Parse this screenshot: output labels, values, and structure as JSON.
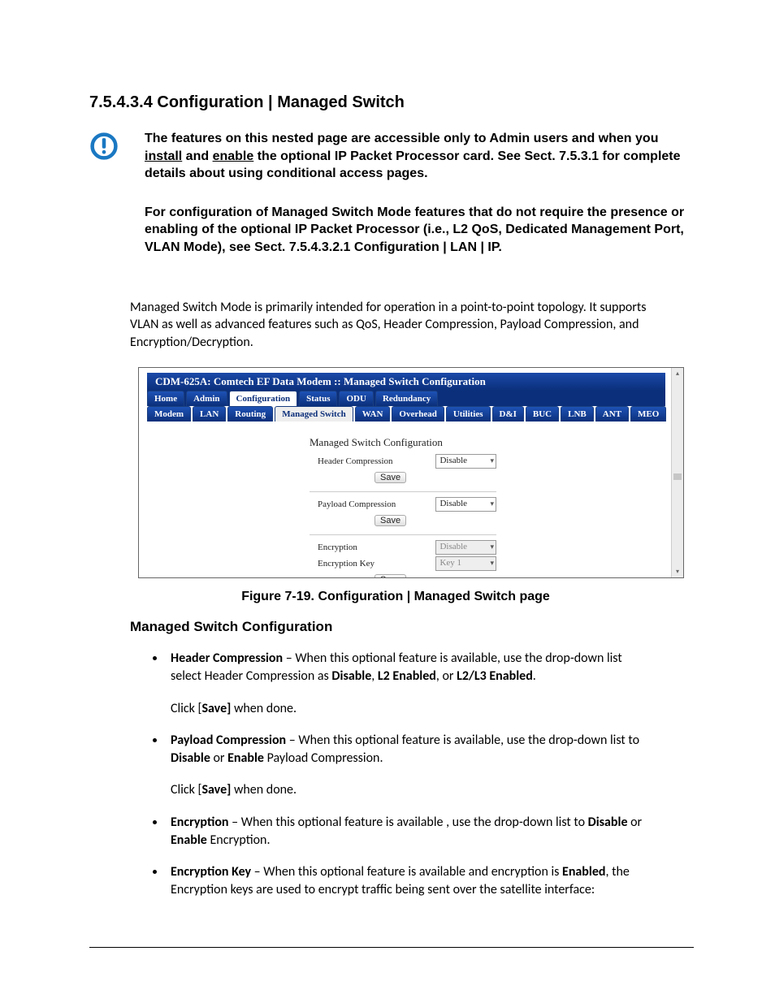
{
  "heading": "7.5.4.3.4 Configuration | Managed Switch",
  "note": {
    "p1_a": "The features on this nested page are accessible only to Admin users and when you ",
    "p1_u1": "install",
    "p1_b": " and ",
    "p1_u2": "enable",
    "p1_c": " the optional IP Packet Processor card. See Sect. 7.5.3.1 for complete details about using conditional access pages.",
    "p2": "For configuration of Managed Switch Mode features that do not require the presence or enabling of the optional IP Packet Processor (i.e., L2 QoS, Dedicated Management Port, VLAN Mode), see Sect. 7.5.4.3.2.1 Configuration | LAN | IP."
  },
  "intro": "Managed Switch Mode is primarily intended for operation in a point-to-point topology. It supports VLAN as well as advanced features such as QoS, Header Compression, Payload Compression, and Encryption/Decryption.",
  "fig": {
    "titlebar": "CDM-625A: Comtech EF Data Modem :: Managed Switch Configuration",
    "tabs1": [
      "Home",
      "Admin",
      "Configuration",
      "Status",
      "ODU",
      "Redundancy"
    ],
    "tabs1_active": "Configuration",
    "tabs2": [
      "Modem",
      "LAN",
      "Routing",
      "Managed Switch",
      "WAN",
      "Overhead",
      "Utilities",
      "D&I",
      "BUC",
      "LNB",
      "ANT",
      "MEO"
    ],
    "tabs2_active": "Managed Switch",
    "form": {
      "title": "Managed Switch Configuration",
      "hc_label": "Header Compression",
      "hc_value": "Disable",
      "pc_label": "Payload Compression",
      "pc_value": "Disable",
      "enc_label": "Encryption",
      "enc_value": "Disable",
      "key_label": "Encryption Key",
      "key_value": "Key 1",
      "save": "Save"
    }
  },
  "caption": "Figure 7-19. Configuration | Managed Switch page",
  "subhead": "Managed Switch Configuration",
  "list": {
    "hc_bold": "Header Compression",
    "hc_text": " – When this optional feature is available, use the drop-down list select Header Compression as ",
    "hc_b1": "Disable",
    "hc_s1": ",  ",
    "hc_b2": "L2 Enabled",
    "hc_s2": ", or ",
    "hc_b3": "L2/L3 Enabled",
    "hc_end": ".",
    "click_a": "Click [",
    "click_save": "Save]",
    "click_b": " when done.",
    "pc_bold": "Payload Compression",
    "pc_text": " – When this optional feature is available, use the drop-down list to ",
    "pc_b1": "Disable",
    "pc_s1": " or ",
    "pc_b2": "Enable",
    "pc_end": " Payload Compression.",
    "enc_bold": "Encryption",
    "enc_text": " – When this optional feature is available , use the drop-down list to ",
    "enc_b1": "Disable",
    "enc_s1": " or ",
    "enc_b2": "Enable",
    "enc_end": " Encryption.",
    "key_bold": "Encryption Key",
    "key_text": " – When this optional feature is available and encryption is ",
    "key_b1": "Enabled",
    "key_end": ", the Encryption keys are used to encrypt traffic being sent over the satellite interface:"
  }
}
